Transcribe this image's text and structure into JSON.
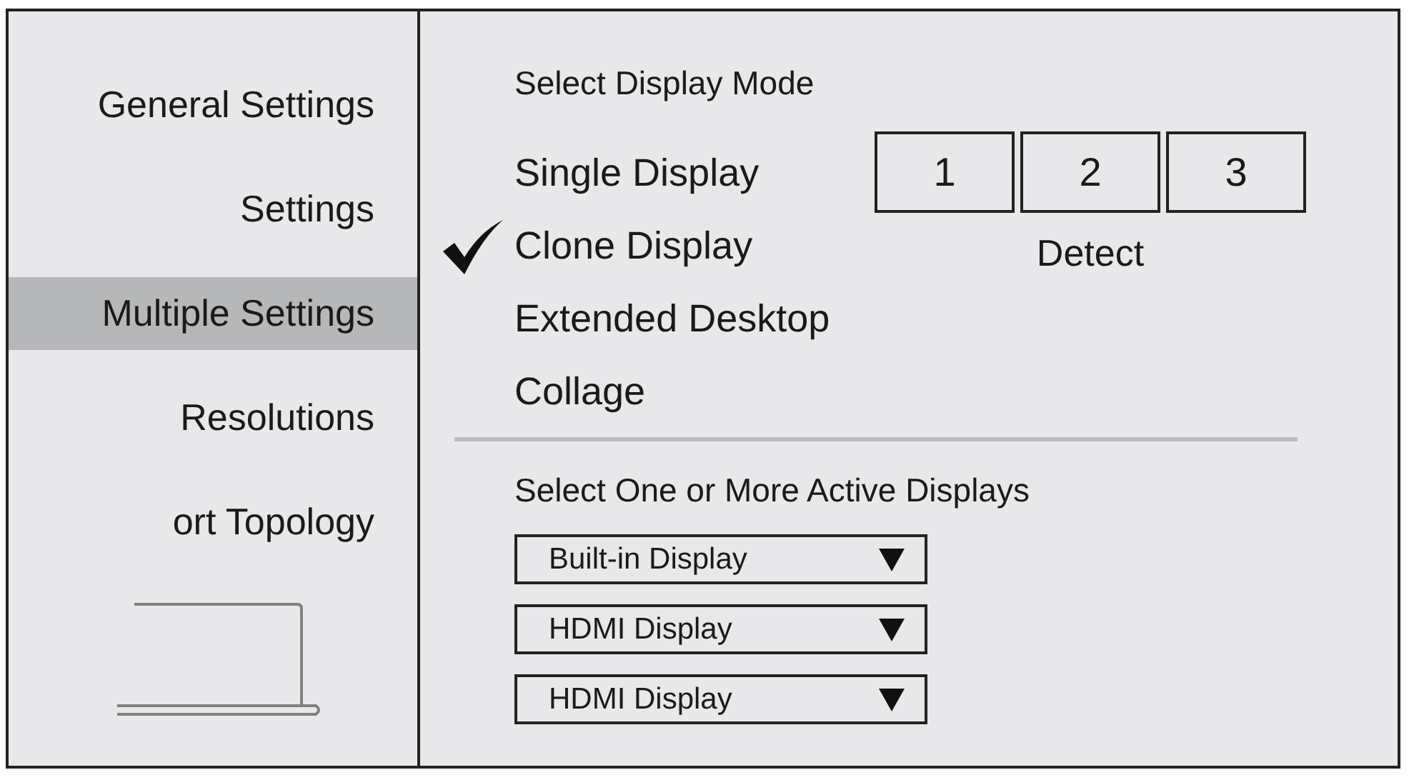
{
  "sidebar": {
    "items": [
      {
        "label": "General Settings",
        "selected": false
      },
      {
        "label": "Settings",
        "selected": false
      },
      {
        "label": "Multiple Settings",
        "selected": true
      },
      {
        "label": "Resolutions",
        "selected": false
      },
      {
        "label": "ort Topology",
        "selected": false
      }
    ]
  },
  "display_mode": {
    "title": "Select Display Mode",
    "modes": [
      {
        "label": "Single Display",
        "checked": false
      },
      {
        "label": "Clone Display",
        "checked": true
      },
      {
        "label": "Extended Desktop",
        "checked": false
      },
      {
        "label": "Collage",
        "checked": false
      }
    ],
    "monitors": [
      {
        "label": "1"
      },
      {
        "label": "2"
      },
      {
        "label": "3"
      }
    ],
    "detect_label": "Detect"
  },
  "active_displays": {
    "title": "Select One or More Active Displays",
    "dropdowns": [
      {
        "value": "Built-in Display"
      },
      {
        "value": "HDMI Display"
      },
      {
        "value": "HDMI Display"
      }
    ]
  }
}
